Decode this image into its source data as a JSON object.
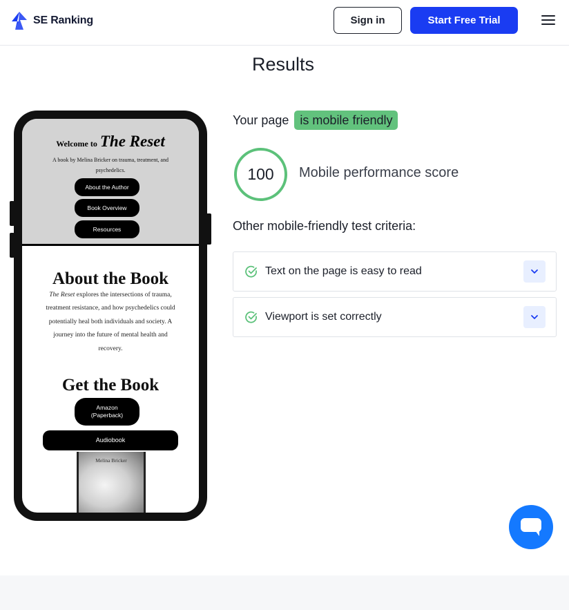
{
  "header": {
    "logo_text": "SE Ranking",
    "signin_label": "Sign in",
    "trial_label": "Start Free Trial",
    "brand_color": "#1a3cf2"
  },
  "results": {
    "title": "Results",
    "your_page": "Your page",
    "status_badge": "is mobile friendly",
    "score": "100",
    "score_label": "Mobile performance score",
    "criteria_title": "Other mobile-friendly test criteria:",
    "criteria": [
      {
        "label": "Text on the page is easy to read",
        "icon": "check-circle-icon"
      },
      {
        "label": "Viewport is set correctly",
        "icon": "check-circle-icon"
      }
    ],
    "success_color": "#5cc17a"
  },
  "preview": {
    "welcome": "Welcome to",
    "title": "The Reset",
    "subtitle": "A book by Melina Bricker on trauma, treatment, and psychedelics.",
    "nav": [
      "About the Author",
      "Book Overview",
      "Resources"
    ],
    "about_heading": "About the Book",
    "about_title_italic": "The Reset",
    "about_text": " explores the intersections of trauma, treatment resistance, and how psychedelics could potentially heal both individuals and society. A journey into the future of mental health and recovery.",
    "get_heading": "Get the Book",
    "amazon_line1": "Amazon",
    "amazon_line2": "(Paperback)",
    "audiobook": "Audiobook",
    "book_author": "Melina Bricker"
  }
}
